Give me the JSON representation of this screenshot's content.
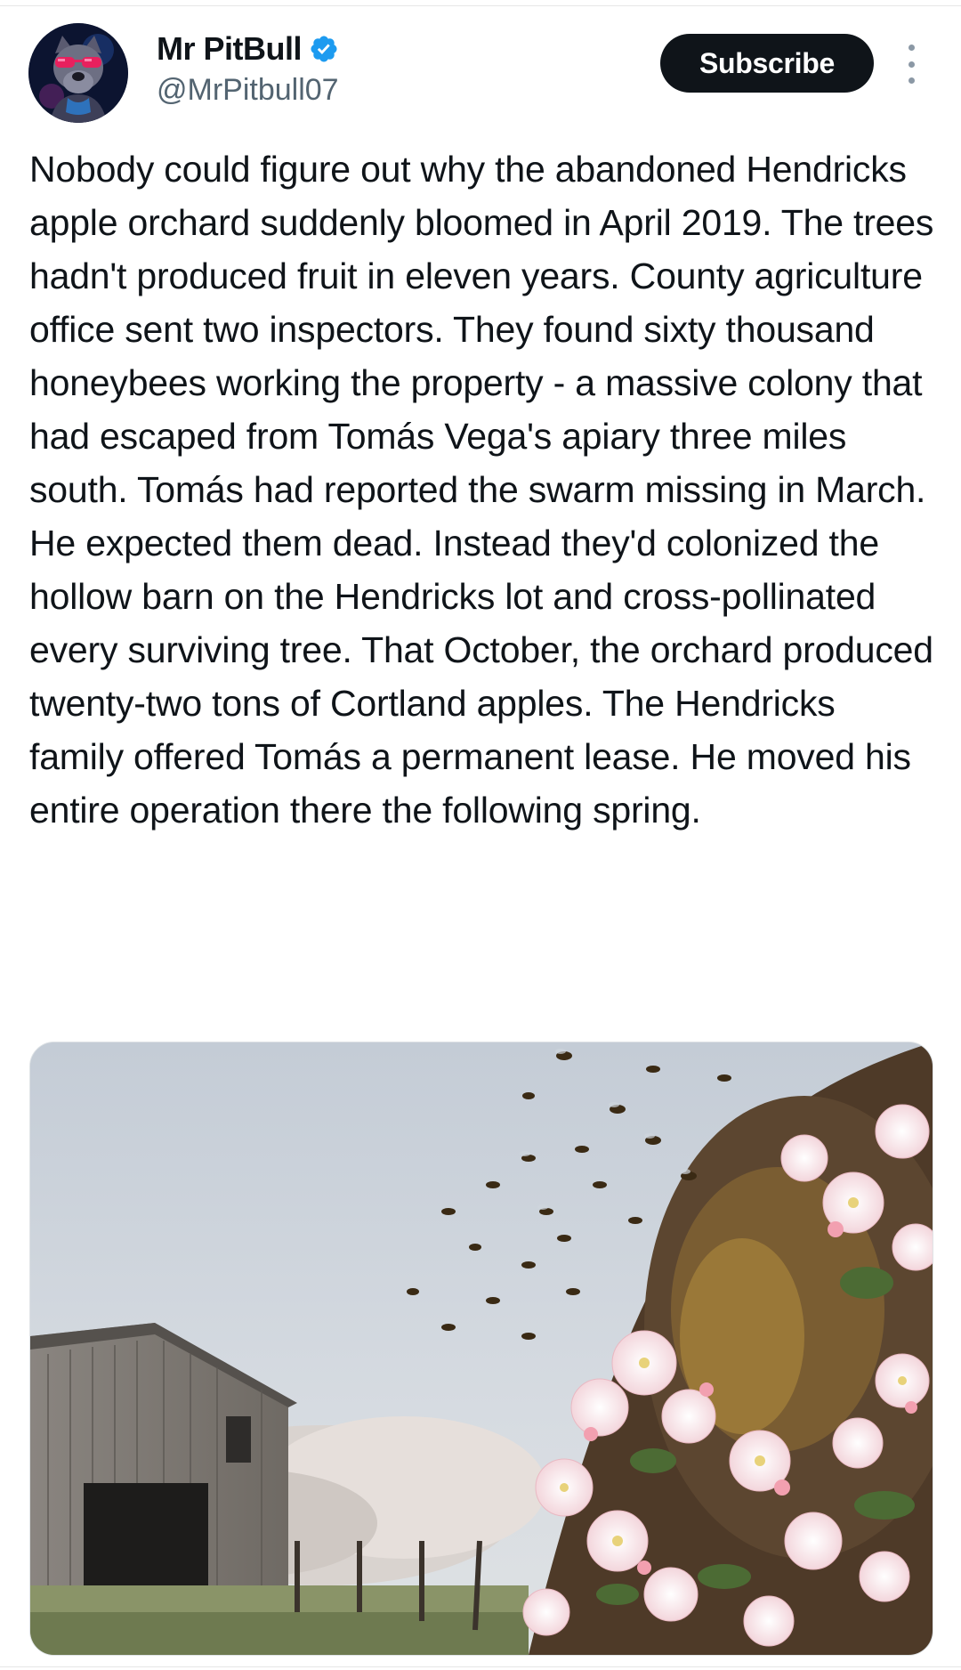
{
  "post": {
    "author": {
      "display_name": "Mr PitBull",
      "handle": "@MrPitbull07",
      "verified": true,
      "avatar_icon": "pitbull-avatar-with-neon-sunglasses"
    },
    "subscribe_label": "Subscribe",
    "more_icon": "more-vertical-icon",
    "text": "Nobody could figure out why the abandoned Hendricks apple orchard suddenly bloomed in April 2019. The trees hadn't produced fruit in eleven years. County agriculture office sent two inspectors. They found sixty thousand honeybees working the property - a massive colony that had escaped from Tomás Vega's apiary three miles south. Tomás had reported the swarm missing in March. He expected them dead. Instead they'd colonized the hollow barn on the Hendricks lot and cross-pollinated every surviving tree. That October, the orchard produced twenty-two tons of Cortland apples. The Hendricks family offered Tomás a permanent lease. He moved his entire operation there the following spring.",
    "media": {
      "kind": "photo",
      "subject": "bee-swarm-over-blooming-apple-orchard-with-barn"
    }
  },
  "colors": {
    "text_primary": "#0f1419",
    "text_secondary": "#536471",
    "verified_blue": "#1d9bf0",
    "subscribe_bg": "#0f1419",
    "subscribe_fg": "#ffffff"
  }
}
